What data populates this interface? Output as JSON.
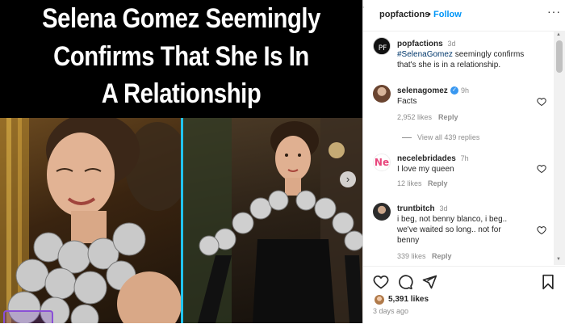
{
  "post": {
    "headline_lines": [
      "Selena Gomez Seemingly",
      "Confirms That She Is In",
      "A Relationship"
    ]
  },
  "header": {
    "username": "popfactions",
    "separator": "•",
    "follow_label": "Follow",
    "more_label": "···"
  },
  "caption": {
    "username": "popfactions",
    "time": "3d",
    "hashtag": "#SelenaGomez",
    "text_line1": " seemingly confirms",
    "text_line2": "that's she is in a relationship."
  },
  "comments": [
    {
      "username": "selenagomez",
      "verified": true,
      "time": "9h",
      "text": "Facts",
      "likes": "2,952 likes",
      "reply_label": "Reply",
      "view_replies": "View all 439 replies"
    },
    {
      "username": "necelebridades",
      "avatar_letter": "Ne",
      "time": "7h",
      "text": "I love my queen",
      "likes": "12 likes",
      "reply_label": "Reply"
    },
    {
      "username": "truntbitch",
      "time": "3d",
      "text_lines": [
        "i beg, not benny blanco, i beg..",
        "we've waited so long.. not for",
        "benny"
      ],
      "likes": "339 likes",
      "reply_label": "Reply"
    }
  ],
  "footer": {
    "likes_count": "5,391 likes",
    "posted": "3 days ago"
  },
  "icons": {
    "heart": "heart-icon",
    "comment": "comment-icon",
    "share": "share-icon",
    "save": "bookmark-icon"
  },
  "colors": {
    "link_blue": "#0095f6",
    "hashtag_blue": "#00376b",
    "verified_blue": "#3897f0",
    "divider_cyan": "#21c4ef"
  }
}
